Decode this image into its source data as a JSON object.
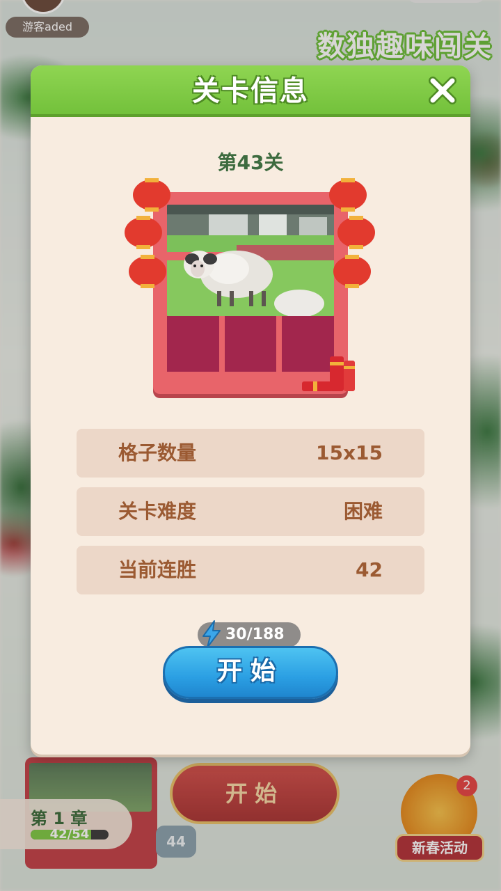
{
  "background": {
    "username": "游客aded",
    "watermark": "数独趣味闯关",
    "chapter": {
      "name": "第 1 章",
      "progress_text": "42/54",
      "progress_fraction": 0.78
    },
    "start_button_label": "开始",
    "current_level_badge": "44",
    "event": {
      "label": "新春活动",
      "badge_count": "2"
    }
  },
  "modal": {
    "title": "关卡信息",
    "level_label": "第43关",
    "info_rows": [
      {
        "label": "格子数量",
        "value": "15x15"
      },
      {
        "label": "关卡难度",
        "value": "困难"
      },
      {
        "label": "当前连胜",
        "value": "42"
      }
    ],
    "energy": "30/188",
    "start_label": "开始"
  },
  "colors": {
    "header_green": "#7dc844",
    "start_blue": "#2b9fe3",
    "info_text": "#9b5a32",
    "level_green": "#3d6b3f"
  },
  "icons": {
    "close": "close-icon",
    "energy": "lightning-icon",
    "lantern": "lantern-icon",
    "firecracker": "firecracker-icon"
  }
}
